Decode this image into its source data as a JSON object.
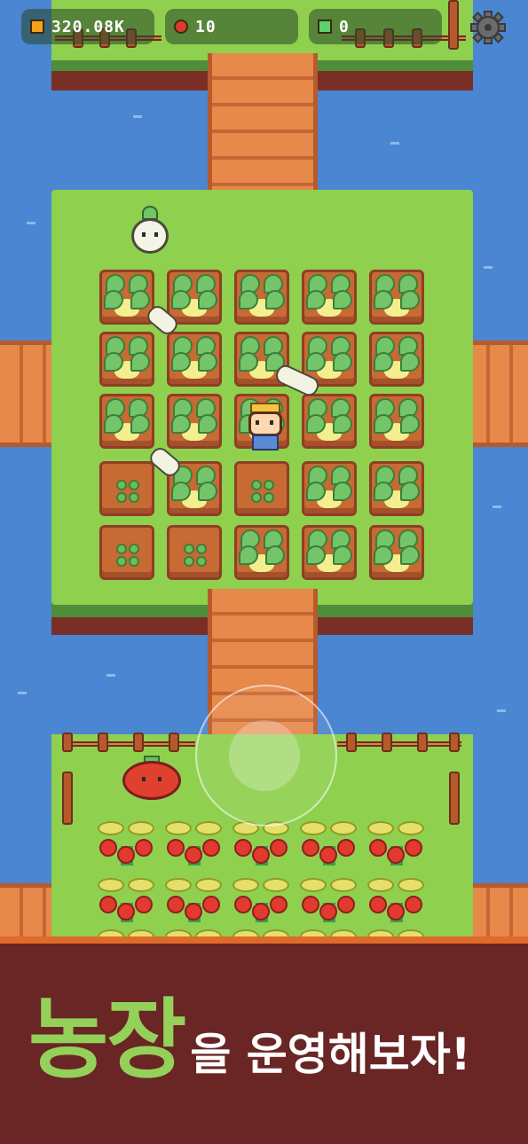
{
  "hud": {
    "gold": "320.08K",
    "tomatoes": "10",
    "gems": "0",
    "gold_icon": "gold-coin-icon",
    "tomato_icon": "tomato-icon",
    "gem_icon": "green-gem-icon",
    "settings_icon": "gear-icon"
  },
  "banner": {
    "title_big": "농장",
    "title_rest": "을 운영해보자!"
  },
  "colors": {
    "accent_green": "#93d15a",
    "banner_bg": "#6a2525",
    "banner_stripe": "#e06a2a",
    "water": "#4a86d1"
  }
}
